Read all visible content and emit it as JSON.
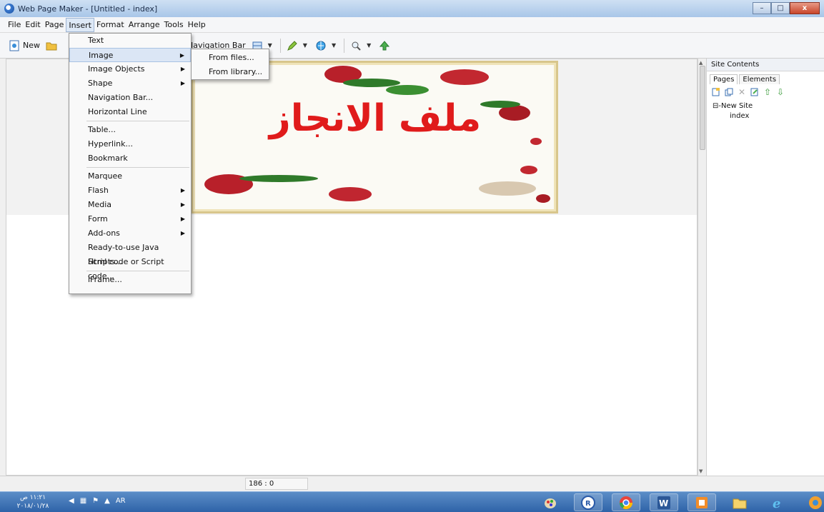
{
  "window": {
    "title": "Web Page Maker - [Untitled - index]",
    "minimize": "–",
    "maximize": "□",
    "close": "x"
  },
  "menubar": [
    "File",
    "Edit",
    "Page",
    "Insert",
    "Format",
    "Arrange",
    "Tools",
    "Help"
  ],
  "toolbar": {
    "new_label": "New",
    "navbar_label": "Navigation Bar"
  },
  "insert_menu": {
    "items": [
      {
        "label": "Text",
        "submenu": false
      },
      {
        "label": "Image",
        "submenu": true
      },
      {
        "label": "Image Objects",
        "submenu": true
      },
      {
        "label": "Shape",
        "submenu": true
      },
      {
        "label": "Navigation Bar...",
        "submenu": false
      },
      {
        "label": "Horizontal Line",
        "submenu": false
      },
      {
        "label": "Table...",
        "submenu": false
      },
      {
        "label": "Hyperlink...",
        "submenu": false
      },
      {
        "label": "Bookmark",
        "submenu": false
      },
      {
        "label": "Marquee",
        "submenu": false
      },
      {
        "label": "Flash",
        "submenu": true
      },
      {
        "label": "Media",
        "submenu": true
      },
      {
        "label": "Form",
        "submenu": true
      },
      {
        "label": "Add-ons",
        "submenu": true
      },
      {
        "label": "Ready-to-use Java Scripts...",
        "submenu": false
      },
      {
        "label": "Html code or Script code...",
        "submenu": false
      },
      {
        "label": "iFrame...",
        "submenu": false
      }
    ],
    "highlighted": "Image",
    "submenu_arrow": "▶"
  },
  "image_submenu": [
    "From files...",
    "From library..."
  ],
  "canvas": {
    "banner_text": "ملف الانجاز"
  },
  "status": {
    "coords": "186 : 0"
  },
  "site_panel": {
    "title": "Site Contents",
    "tabs": [
      "Pages",
      "Elements"
    ],
    "tree_root": "⊟-New Site",
    "tree_child": "index"
  },
  "taskbar": {
    "time": "١١:٢١ ص",
    "date": "٢٠١٨/٠١/٢٨",
    "lang": "AR"
  },
  "colors": {
    "banner_text": "#e01b1b",
    "menu_highlight": "#dbe6f5",
    "taskbar": "#2e63a8"
  }
}
